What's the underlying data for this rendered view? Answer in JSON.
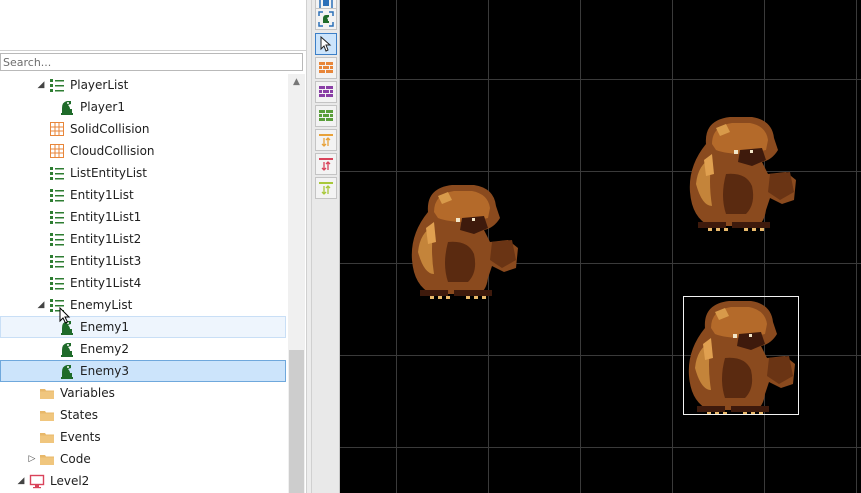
{
  "search": {
    "placeholder": "Search..."
  },
  "tree": {
    "items": [
      {
        "label": "PlayerList",
        "icon": "list-icon",
        "expander": "expanded"
      },
      {
        "label": "Player1",
        "icon": "entity-icon"
      },
      {
        "label": "SolidCollision",
        "icon": "collision-grid-icon"
      },
      {
        "label": "CloudCollision",
        "icon": "collision-grid-icon"
      },
      {
        "label": "ListEntityList",
        "icon": "list-icon"
      },
      {
        "label": "Entity1List",
        "icon": "list-icon"
      },
      {
        "label": "Entity1List1",
        "icon": "list-icon"
      },
      {
        "label": "Entity1List2",
        "icon": "list-icon"
      },
      {
        "label": "Entity1List3",
        "icon": "list-icon"
      },
      {
        "label": "Entity1List4",
        "icon": "list-icon"
      },
      {
        "label": "EnemyList",
        "icon": "list-icon",
        "expander": "expanded"
      },
      {
        "label": "Enemy1",
        "icon": "entity-icon",
        "state": "hover"
      },
      {
        "label": "Enemy2",
        "icon": "entity-icon"
      },
      {
        "label": "Enemy3",
        "icon": "entity-icon",
        "state": "selected"
      },
      {
        "label": "Variables",
        "icon": "folder-icon"
      },
      {
        "label": "States",
        "icon": "folder-icon"
      },
      {
        "label": "Events",
        "icon": "folder-icon"
      },
      {
        "label": "Code",
        "icon": "folder-icon",
        "expander": "collapsed"
      },
      {
        "label": "Level2",
        "icon": "screen-icon",
        "expander": "expanded"
      }
    ]
  },
  "toolbar": {
    "buttons": [
      {
        "name": "zoom-fit-icon",
        "active": false
      },
      {
        "name": "focus-entity-icon",
        "active": false
      },
      {
        "name": "pointer-select-icon",
        "active": true
      },
      {
        "name": "orange-brick-layer-icon",
        "active": false
      },
      {
        "name": "purple-brick-layer-icon",
        "active": false
      },
      {
        "name": "green-brick-layer-icon",
        "active": false
      },
      {
        "name": "orange-layer-arrows-icon",
        "active": false
      },
      {
        "name": "pink-layer-arrows-icon",
        "active": false
      },
      {
        "name": "lime-layer-arrows-icon",
        "active": false
      }
    ]
  },
  "canvas": {
    "background": "#000000",
    "grid_color": "#3a3a3a",
    "sprites": [
      {
        "name": "bear-sprite-enemy1",
        "sprite": "bear"
      },
      {
        "name": "bear-sprite-enemy2",
        "sprite": "bear"
      },
      {
        "name": "bear-sprite-enemy3",
        "sprite": "bear",
        "selected": true
      }
    ]
  },
  "colors": {
    "selection_fill": "#cce4fb",
    "selection_border": "#6fa8dc",
    "hover_fill": "#eef5fd",
    "list_icon": "#2e7d32",
    "folder": "#e8b86a",
    "collision": "#e8863a",
    "screen_icon": "#d9435a"
  }
}
